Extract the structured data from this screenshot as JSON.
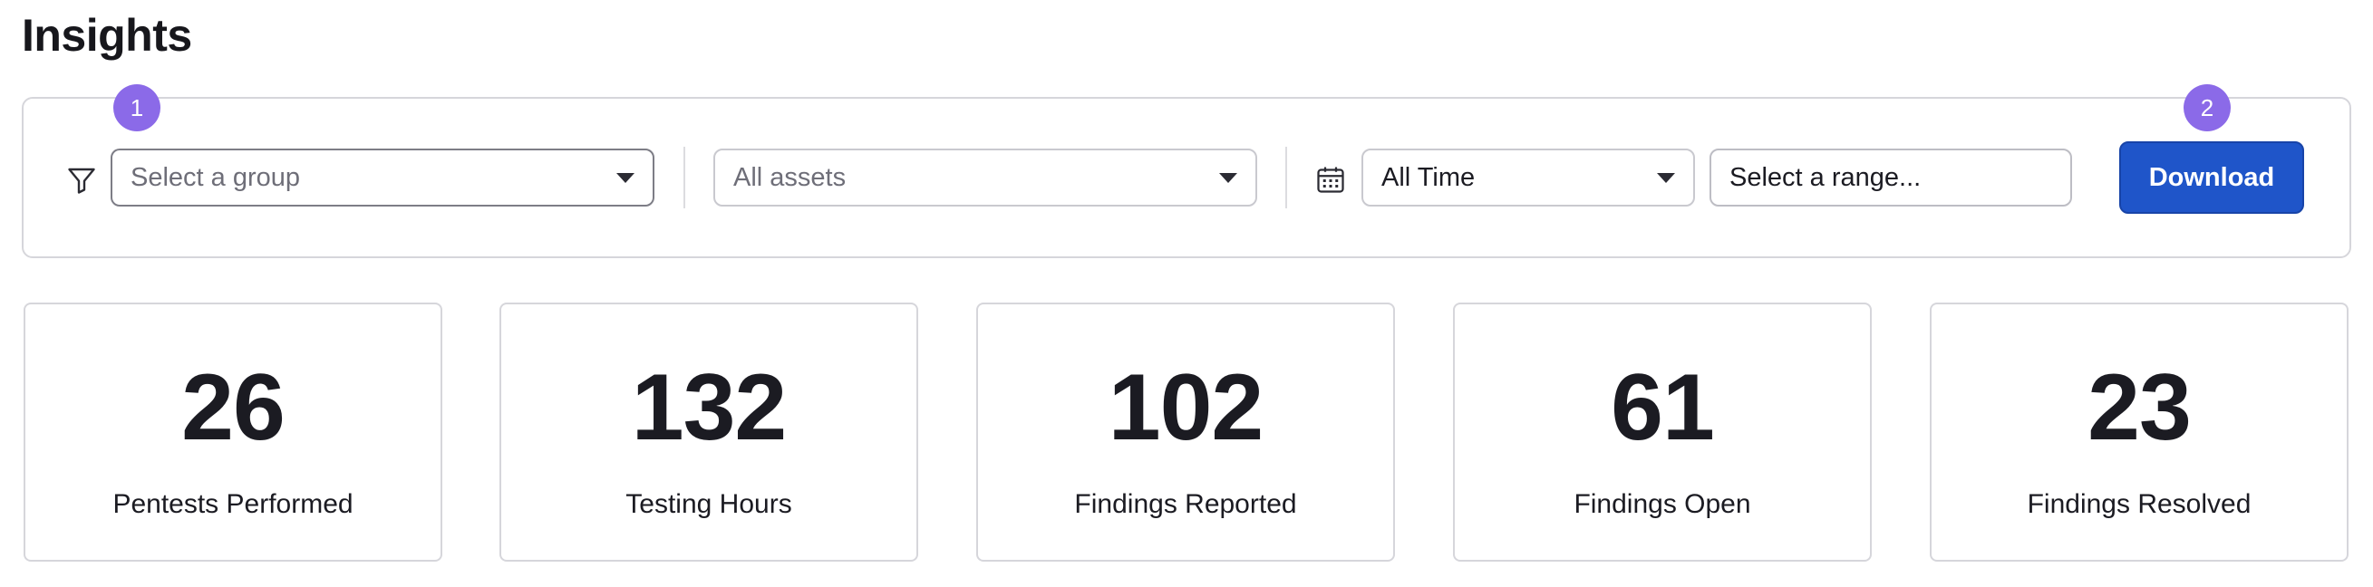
{
  "header": {
    "title": "Insights"
  },
  "filters": {
    "group": {
      "placeholder": "Select a group"
    },
    "assets": {
      "placeholder": "All assets"
    },
    "time": {
      "value": "All Time"
    },
    "range": {
      "placeholder": "Select a range..."
    },
    "download_label": "Download"
  },
  "badges": [
    "1",
    "2"
  ],
  "stats": [
    {
      "value": "26",
      "label": "Pentests Performed"
    },
    {
      "value": "132",
      "label": "Testing Hours"
    },
    {
      "value": "102",
      "label": "Findings Reported"
    },
    {
      "value": "61",
      "label": "Findings Open"
    },
    {
      "value": "23",
      "label": "Findings Resolved"
    }
  ],
  "colors": {
    "accent": "#1f55c9",
    "badge": "#8b6ae8"
  },
  "icons": {
    "filter": "filter-icon",
    "calendar": "calendar-icon",
    "dropdown": "chevron-down-icon"
  }
}
